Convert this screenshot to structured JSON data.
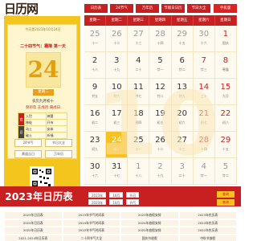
{
  "logo": {
    "text": "日历网",
    "sub": "RILIWANG.COM"
  },
  "nav": [
    "日历表",
    "24节气",
    "万年历",
    "节假日日历",
    "节日大全",
    "手机版"
  ],
  "left": {
    "date_line": "今天是2023年10月24日",
    "solar_term": "二十四节气：霜降 第一天",
    "day": "24",
    "weekday": "星期二",
    "lunar": "农历九月初十",
    "ganzhi": "癸卯年 壬戌月 庚戌日",
    "yi_label": "宜",
    "ji_label": "忌",
    "yi": [
      "入殓",
      "嫁娶",
      "移徙",
      "开市"
    ],
    "ji": [
      "动土",
      "安床",
      "破土",
      "祈福"
    ],
    "buttons": [
      "24节气",
      "节日大全",
      "黄道吉日",
      "万年历"
    ]
  },
  "calendar": {
    "headers": [
      "星期一",
      "星期二",
      "星期三",
      "星期四",
      "星期五",
      "星期六",
      "星期日"
    ],
    "rows": [
      [
        {
          "d": "25",
          "l": "十一"
        },
        {
          "d": "26",
          "l": "十二"
        },
        {
          "d": "27",
          "l": "十三"
        },
        {
          "d": "28",
          "l": "十四"
        },
        {
          "d": "29",
          "l": "十五"
        },
        {
          "d": "30",
          "l": "十六"
        },
        {
          "d": "1",
          "l": "国庆"
        }
      ],
      [
        {
          "d": "2",
          "l": "十八"
        },
        {
          "d": "3",
          "l": "十九"
        },
        {
          "d": "4",
          "l": "二十"
        },
        {
          "d": "5",
          "l": "廿一"
        },
        {
          "d": "6",
          "l": "廿二"
        },
        {
          "d": "7",
          "l": "廿三"
        },
        {
          "d": "8",
          "l": "寒露"
        }
      ],
      [
        {
          "d": "9",
          "l": "廿五"
        },
        {
          "d": "10",
          "l": "廿六"
        },
        {
          "d": "11",
          "l": "廿七"
        },
        {
          "d": "12",
          "l": "廿八"
        },
        {
          "d": "13",
          "l": "廿九"
        },
        {
          "d": "14",
          "l": "三十"
        },
        {
          "d": "15",
          "l": "九月"
        }
      ],
      [
        {
          "d": "16",
          "l": "初二"
        },
        {
          "d": "17",
          "l": "初三"
        },
        {
          "d": "18",
          "l": "初四"
        },
        {
          "d": "19",
          "l": "初五"
        },
        {
          "d": "20",
          "l": "初六"
        },
        {
          "d": "21",
          "l": "初七"
        },
        {
          "d": "22",
          "l": "初八"
        }
      ],
      [
        {
          "d": "23",
          "l": "初九"
        },
        {
          "d": "24",
          "l": "初十"
        },
        {
          "d": "25",
          "l": "十一"
        },
        {
          "d": "26",
          "l": "十二"
        },
        {
          "d": "27",
          "l": "十三"
        },
        {
          "d": "28",
          "l": "十四"
        },
        {
          "d": "29",
          "l": "十五"
        }
      ],
      [
        {
          "d": "30",
          "l": "十六"
        },
        {
          "d": "31",
          "l": "十七"
        },
        {
          "d": "1",
          "l": "十八"
        },
        {
          "d": "2",
          "l": "十九"
        },
        {
          "d": "3",
          "l": "二十"
        },
        {
          "d": "4",
          "l": "廿一"
        },
        {
          "d": "5",
          "l": "廿二"
        }
      ]
    ],
    "watermark": "10"
  },
  "banner": {
    "title": "2023年日历表",
    "sel1": [
      "2023年",
      "10月",
      "节日"
    ],
    "sel2": [
      "2023年",
      "10月",
      "节气"
    ],
    "btn1": "查询",
    "btn2": "查询"
  },
  "links": [
    "2023年日历表",
    "2023年节气时间表",
    "2023年放假安排",
    "2023年农历表",
    "2024年日历表",
    "2024年节气时间表",
    "2024年放假安排",
    "2024年农历表",
    "2022年日历表",
    "2022年节气时间表",
    "2022年放假安排",
    "2022年农历表",
    "2021-2024年日历表",
    "二十四节气大全",
    "国庆节放假",
    "中秋节放假"
  ]
}
